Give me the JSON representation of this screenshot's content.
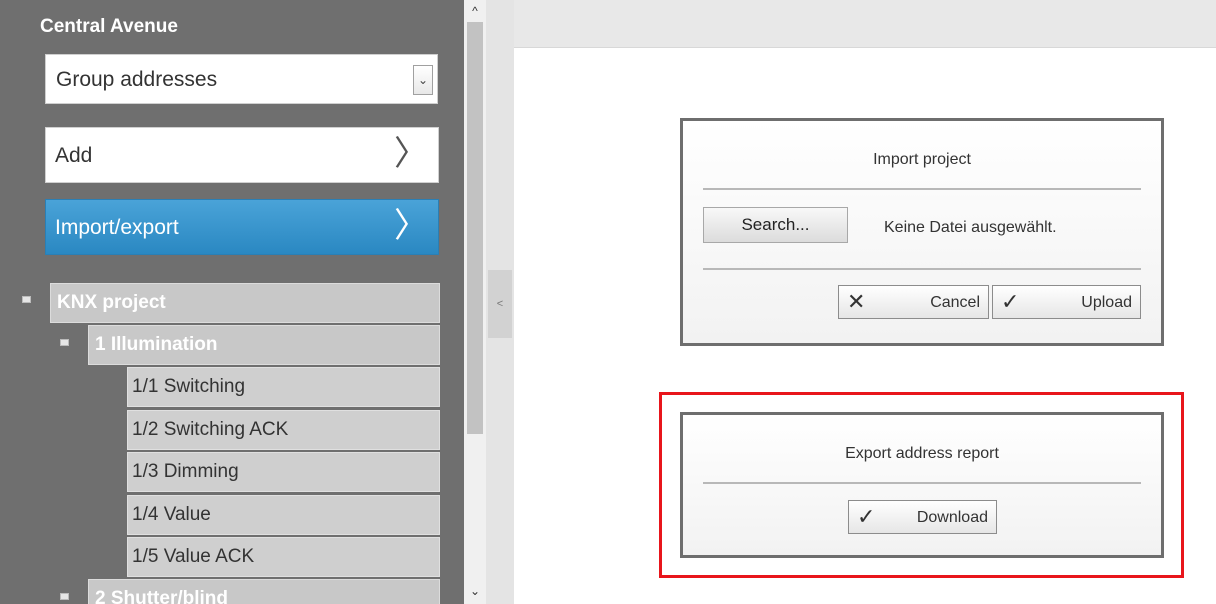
{
  "sidebar": {
    "title": "Central Avenue",
    "select": {
      "value": "Group addresses",
      "arrow": "⌄"
    },
    "add_label": "Add",
    "import_label": "Import/export",
    "chevron": "〉",
    "tree": {
      "root": "KNX project",
      "group1": "1 Illumination",
      "leaves": [
        "1/1 Switching",
        "1/2 Switching ACK",
        "1/3 Dimming",
        "1/4 Value",
        "1/5 Value ACK"
      ],
      "group2": "2 Shutter/blind"
    }
  },
  "scrollbar": {
    "up": "^",
    "down": "⌄"
  },
  "splitter": {
    "handle": "<"
  },
  "import_dialog": {
    "title": "Import project",
    "search_label": "Search...",
    "no_file_text": "Keine Datei ausgewählt.",
    "cancel_label": "Cancel",
    "cancel_icon": "✕",
    "upload_label": "Upload",
    "upload_icon": "✓"
  },
  "export_dialog": {
    "title": "Export address report",
    "download_label": "Download",
    "download_icon": "✓"
  },
  "colors": {
    "sidebar_bg": "#6f6f6f",
    "accent_blue": "#2a88c2",
    "highlight_red": "#e8151b"
  }
}
